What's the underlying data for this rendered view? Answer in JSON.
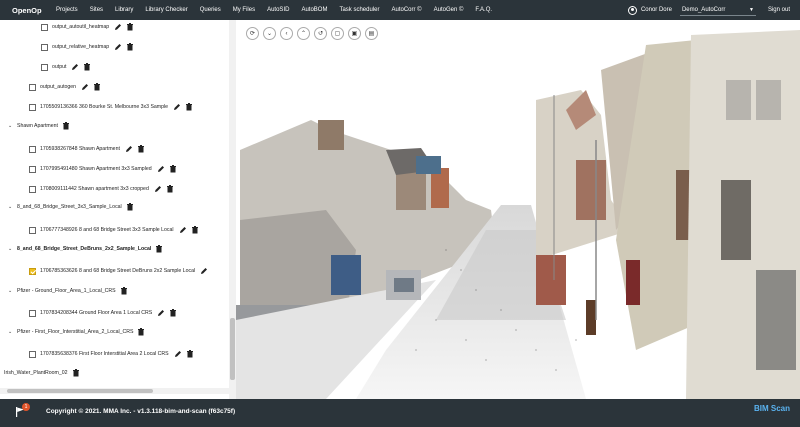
{
  "navbar": {
    "brand": "OpenOp",
    "items": [
      "Projects",
      "Sites",
      "Library",
      "Library Checker",
      "Queries",
      "My Files",
      "AutoSID",
      "AutoBOM",
      "Task scheduler",
      "AutoCorr ©",
      "AutoGen ©",
      "F.A.Q."
    ],
    "user": "Conor Dore",
    "project": "Demo_AutoCorr",
    "signout": "Sign out"
  },
  "tree": {
    "items": [
      {
        "label": "output_autoutil_heatmap"
      },
      {
        "label": "output_relative_heatmap"
      },
      {
        "label": "output"
      },
      {
        "label": "output_autogen"
      },
      {
        "label": "1705509136366 360 Bourke St. Melbourne 3x3 Sample"
      },
      {
        "label": "Shawn Apartment"
      },
      {
        "label": "1705938267848 Shawn Apartment"
      },
      {
        "label": "1707995491480 Shawn Apartment 3x3 Sampled"
      },
      {
        "label": "1708009111442 Shawn apartment 3x3 cropped"
      },
      {
        "label": "8_and_68_Bridge_Street_3x3_Sample_Local"
      },
      {
        "label": "1706777348926 8 and 68 Bridge Street 3x3 Sample Local"
      },
      {
        "label": "8_and_68_Bridge_Street_DeBruns_2x2_Sample_Local"
      },
      {
        "label": "1706785363626 8 and 68 Bridge Street DeBruns 2x2 Sample Local"
      },
      {
        "label": "Pfizer - Ground_Floor_Area_1_Local_CRS"
      },
      {
        "label": "1707834208344 Ground Floor Area 1 Local CRS"
      },
      {
        "label": "Pfizer - First_Floor_Interstitial_Area_2_Local_CRS"
      },
      {
        "label": "1707835638376 First Floor Interstitial Area 2 Local CRS"
      },
      {
        "label": "Irish_Water_PlantRoom_02"
      }
    ]
  },
  "viewer": {
    "toolbar": [
      "reset-view-icon",
      "chevron-down-icon",
      "chevron-left-icon",
      "chevron-up-icon",
      "history-icon",
      "square-icon",
      "layers-icon",
      "map-icon"
    ],
    "toolbar_glyphs": [
      "⟳",
      "⌄",
      "‹",
      "⌃",
      "↺",
      "▢",
      "▣",
      "▤"
    ]
  },
  "footer": {
    "copyright": "Copyright © 2021. MMA Inc. - v1.3.118-bim-and-scan (f63c75f)",
    "notification_count": "1",
    "logo": "BIM Scan"
  },
  "colors": {
    "navbar": "#2b343a",
    "checked": "#f0c020",
    "badge": "#e0542a"
  }
}
